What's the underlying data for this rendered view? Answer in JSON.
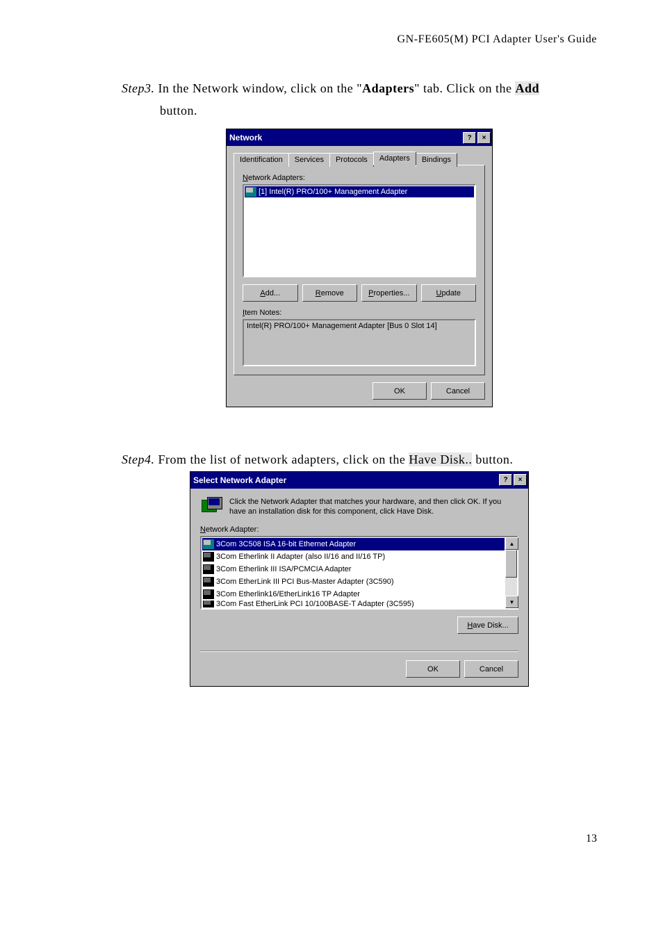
{
  "header": {
    "text": "GN-FE605(M)  PCI  Adapter  User's  Guide"
  },
  "step3": {
    "label": "Step3.",
    "seg1": " In the Network window, click on the \"",
    "adapters": "Adapters",
    "seg2": "\" tab. Click on the ",
    "add": "Add",
    "seg3": "button."
  },
  "networkDialog": {
    "title": "Network",
    "helpGlyph": "?",
    "closeGlyph": "×",
    "tabs": [
      "Identification",
      "Services",
      "Protocols",
      "Adapters",
      "Bindings"
    ],
    "activeTabIndex": 3,
    "adaptersLabel_pre": "N",
    "adaptersLabel_post": "etwork Adapters:",
    "adapterItem": "[1] Intel(R) PRO/100+ Management Adapter",
    "buttons": {
      "add": {
        "u": "A",
        "r": "dd..."
      },
      "remove": {
        "u": "R",
        "r": "emove"
      },
      "properties": {
        "u": "P",
        "r": "roperties..."
      },
      "update": {
        "u": "U",
        "r": "pdate"
      }
    },
    "itemNotesLabel_pre": "I",
    "itemNotesLabel_post": "tem Notes:",
    "itemNotesText": "Intel(R) PRO/100+ Management Adapter [Bus 0 Slot 14]",
    "ok": "OK",
    "cancel": "Cancel"
  },
  "step4": {
    "label": "Step4.",
    "seg1": " From the list of network adapters, click on the ",
    "have": "Have Disk..",
    "seg2": " button."
  },
  "selectDialog": {
    "title": "Select Network Adapter",
    "helpGlyph": "?",
    "closeGlyph": "×",
    "infoText": "Click the Network Adapter that matches your hardware, and then click OK.  If you have an installation disk for this component, click Have Disk.",
    "listLabel_pre": "N",
    "listLabel_post": "etwork Adapter:",
    "items": [
      "3Com 3C508 ISA 16-bit Ethernet Adapter",
      "3Com Etherlink II Adapter (also II/16 and II/16 TP)",
      "3Com Etherlink III ISA/PCMCIA Adapter",
      "3Com EtherLink III PCI Bus-Master Adapter (3C590)",
      "3Com Etherlink16/EtherLink16 TP Adapter",
      "3Com Fast EtherLink PCI 10/100BASE-T Adapter (3C595)"
    ],
    "haveDisk_pre": "H",
    "haveDisk_post": "ave Disk...",
    "ok": "OK",
    "cancel": "Cancel",
    "upGlyph": "▲",
    "downGlyph": "▼"
  },
  "pageNumber": "13"
}
